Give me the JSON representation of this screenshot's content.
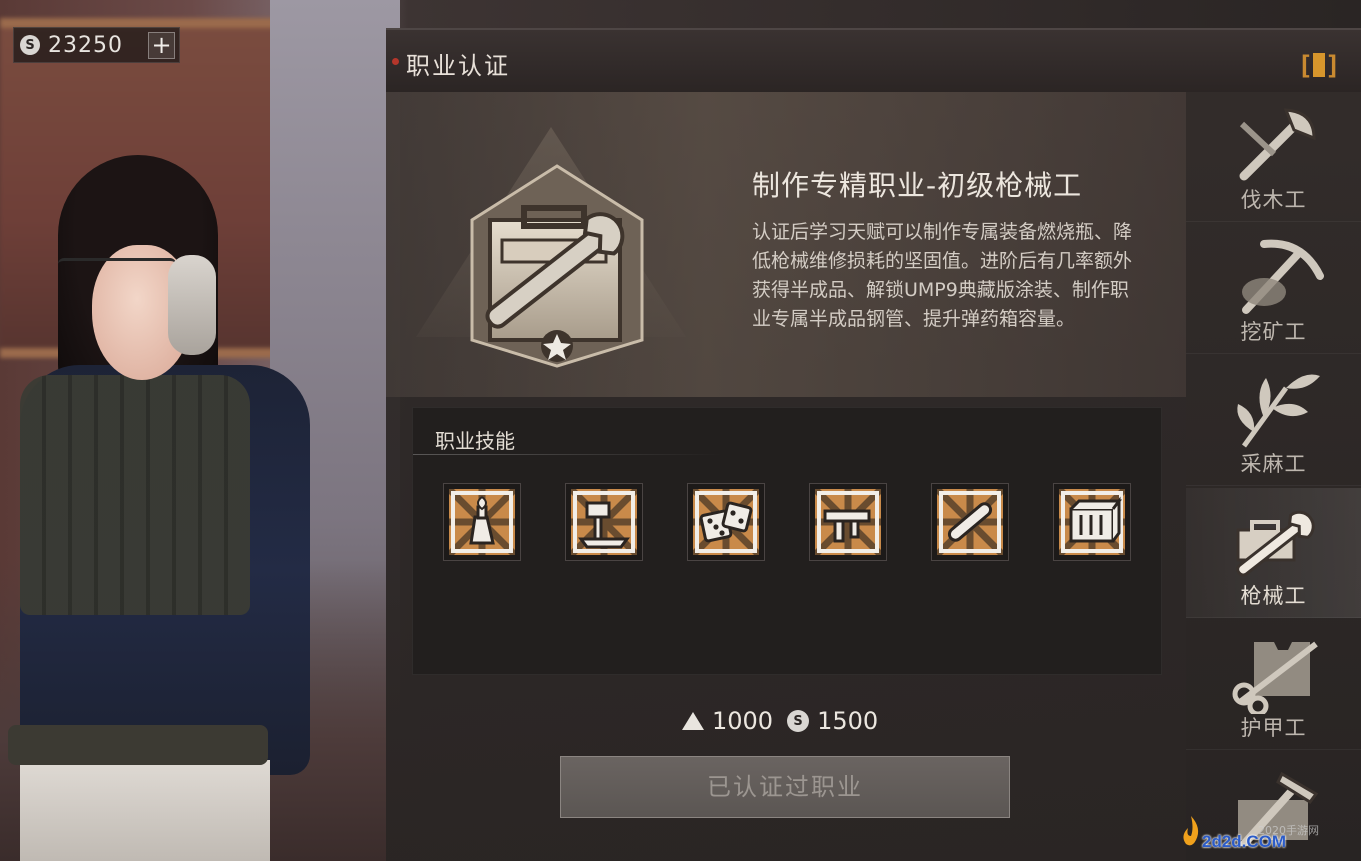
{
  "currency": {
    "icon": "silver-coin-icon",
    "amount": "23250",
    "add_label": "+"
  },
  "panel": {
    "title": "职业认证",
    "info_label": "i"
  },
  "profession": {
    "badge_icon": "wrench-toolbox-badge-icon",
    "title": "制作专精职业-初级枪械工",
    "description": "认证后学习天赋可以制作专属装备燃烧瓶、降低枪械维修损耗的坚固值。进阶后有几率额外获得半成品、解锁UMP9典藏版涂装、制作职业专属半成品钢管、提升弹药箱容量。"
  },
  "skills": {
    "title": "职业技能",
    "items": [
      {
        "icon": "molotov-icon"
      },
      {
        "icon": "hammer-anvil-icon"
      },
      {
        "icon": "dice-icon"
      },
      {
        "icon": "submachine-gun-icon"
      },
      {
        "icon": "steel-pipe-icon"
      },
      {
        "icon": "ammo-crate-icon"
      }
    ]
  },
  "cost": {
    "material_icon": "material-triangle-icon",
    "material_amount": "1000",
    "coin_icon": "silver-coin-icon",
    "coin_amount": "1500"
  },
  "certify_button": {
    "label": "已认证过职业"
  },
  "sidebar": {
    "items": [
      {
        "label": "伐木工",
        "icon": "axe-icon",
        "active": false
      },
      {
        "label": "挖矿工",
        "icon": "pickaxe-icon",
        "active": false
      },
      {
        "label": "采麻工",
        "icon": "hemp-leaf-icon",
        "active": false
      },
      {
        "label": "枪械工",
        "icon": "wrench-icon",
        "active": true
      },
      {
        "label": "护甲工",
        "icon": "scissors-vest-icon",
        "active": false
      },
      {
        "label": "",
        "icon": "hammer-icon",
        "active": false
      }
    ]
  },
  "watermark": {
    "text": "2d2d.COM",
    "sub": "2020手游网"
  },
  "colors": {
    "accent_orange": "#d7962c",
    "header_dot_red": "#b5362b",
    "skill_orange": "#c98a4a",
    "watermark_blue": "#2c5cc8"
  }
}
